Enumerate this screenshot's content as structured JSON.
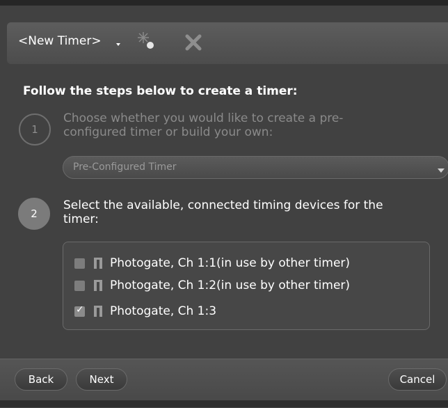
{
  "header": {
    "title": "<New Timer>",
    "icons": [
      "spark-icon",
      "close-icon"
    ]
  },
  "instruction": "Follow the steps below to create a timer:",
  "steps": [
    {
      "number": "1",
      "text": "Choose whether you would like to create a pre-configured timer or build your own:",
      "text_lines": [
        "Choose whether you would like to create a pre-",
        "configured timer or build your own:"
      ]
    },
    {
      "number": "2",
      "text_lines": [
        "Select the available, connected timing devices for the",
        "timer:"
      ]
    }
  ],
  "timer_type_select": {
    "value": "Pre-Configured Timer"
  },
  "devices": [
    {
      "label": "Photogate, Ch 1:1(in use by other timer)",
      "checked": false,
      "icon": "photogate-icon"
    },
    {
      "label": "Photogate, Ch 1:2(in use by other timer)",
      "checked": false,
      "icon": "photogate-icon"
    },
    {
      "label": "Photogate, Ch 1:3",
      "checked": true,
      "icon": "photogate-icon"
    }
  ],
  "footer": {
    "back_label": "Back",
    "next_label": "Next",
    "cancel_label": "Cancel"
  },
  "colors": {
    "background": "#414141",
    "header": "#575757",
    "text": "#ffffff",
    "muted_text": "#8a8a8a"
  }
}
